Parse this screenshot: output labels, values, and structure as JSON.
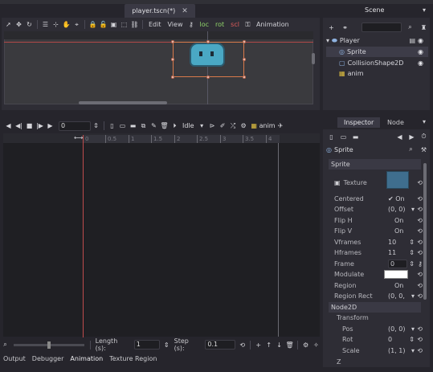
{
  "editor": {
    "tab_title": "player.tscn(*)",
    "tab_close": "✕",
    "toolbar": {
      "edit": "Edit",
      "view": "View",
      "loc": "loc",
      "rot": "rot",
      "scl": "scl",
      "animation": "Animation"
    }
  },
  "scene": {
    "title": "Scene",
    "nodes": [
      {
        "name": "Player",
        "icon": "node2d-icon"
      },
      {
        "name": "Sprite",
        "icon": "sprite-icon",
        "selected": true
      },
      {
        "name": "CollisionShape2D",
        "icon": "collision-icon"
      },
      {
        "name": "anim",
        "icon": "animation-player-icon"
      }
    ]
  },
  "animation": {
    "time": "0",
    "anim_name": "Idle",
    "player_name": "anim",
    "ruler": [
      "0",
      "0.5",
      "1",
      "1.5",
      "2",
      "2.5",
      "3",
      "3.5",
      "4"
    ],
    "length_label": "Length (s):",
    "length_value": "1",
    "step_label": "Step (s):",
    "step_value": "0.1"
  },
  "bottom_tabs": [
    "Output",
    "Debugger",
    "Animation",
    "Texture Region"
  ],
  "inspector": {
    "tabs": [
      "Inspector",
      "Node"
    ],
    "object": "Sprite",
    "section_sprite": "Sprite",
    "section_node2d": "Node2D",
    "texture_label": "Texture",
    "props": [
      {
        "name": "Centered",
        "value": "✔ On"
      },
      {
        "name": "Offset",
        "value": "(0, 0)"
      },
      {
        "name": "Flip H",
        "value": "On"
      },
      {
        "name": "Flip V",
        "value": "On"
      },
      {
        "name": "Vframes",
        "value": "10"
      },
      {
        "name": "Hframes",
        "value": "11"
      },
      {
        "name": "Frame",
        "value": "0"
      },
      {
        "name": "Modulate",
        "value": ""
      },
      {
        "name": "Region",
        "value": "On"
      },
      {
        "name": "Region Rect",
        "value": "(0, 0,"
      }
    ],
    "transform_label": "Transform",
    "transform": [
      {
        "name": "Pos",
        "value": "(0, 0)"
      },
      {
        "name": "Rot",
        "value": "0"
      },
      {
        "name": "Scale",
        "value": "(1, 1)"
      }
    ],
    "z_label": "Z"
  },
  "colors": {
    "accent": "#d97a4a",
    "cursor": "#c04c4c",
    "panel": "#2e2d35"
  }
}
